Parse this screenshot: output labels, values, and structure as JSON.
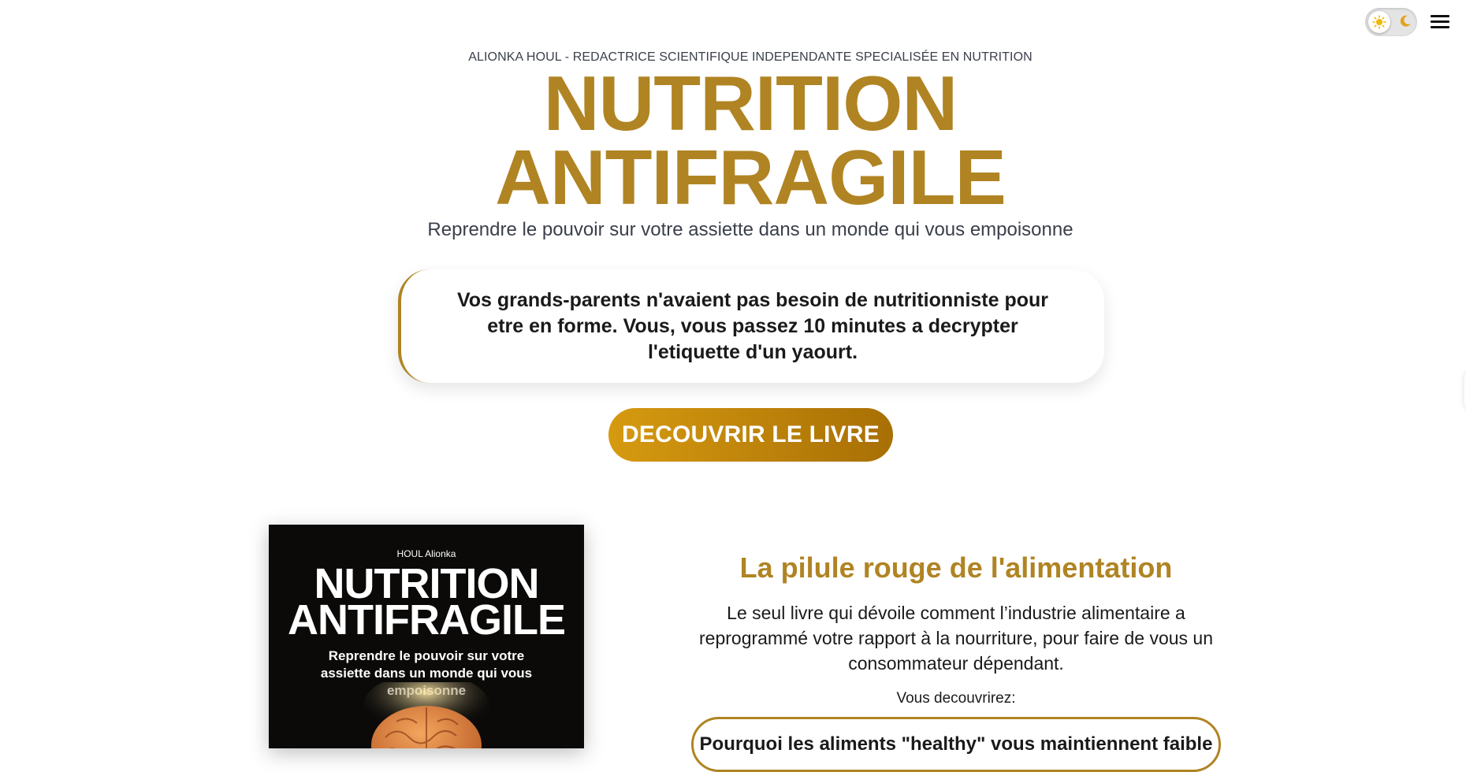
{
  "header": {
    "theme_toggle": {
      "state": "light",
      "light_icon": "sun-icon",
      "dark_icon": "moon-icon"
    },
    "menu_icon": "menu-icon"
  },
  "hero": {
    "kicker": "ALIONKA HOUL - REDACTRICE SCIENTIFIQUE INDEPENDANTE SPECIALISÉE EN NUTRITION",
    "title_line1": "NUTRITION",
    "title_line2": "ANTIFRAGILE",
    "subtitle": "Reprendre le pouvoir sur votre assiette dans un monde qui vous empoisonne",
    "quote": "Vos grands-parents n'avaient pas besoin de nutritionniste pour etre en forme. Vous, vous passez 10 minutes a decrypter l'etiquette d'un yaourt.",
    "cta_label": "DECOUVRIR LE LIVRE"
  },
  "book_cover": {
    "author": "HOUL Alionka",
    "title_line1": "NUTRITION",
    "title_line2": "ANTIFRAGILE",
    "subtitle": "Reprendre le pouvoir sur votre assiette dans un monde qui vous empoisonne",
    "illustration": "brain-illustration"
  },
  "pitch": {
    "heading": "La pilule rouge de l'alimentation",
    "body": "Le seul livre qui dévoile comment l’industrie alimentaire a reprogrammé votre rapport à la nourriture, pour faire de vous un consommateur dépendant.",
    "discover_label": "Vous decouvrirez:",
    "points": [
      "Pourquoi les aliments \"healthy\" vous maintiennent faible"
    ]
  },
  "colors": {
    "accent": "#b08423",
    "cta_start": "#d69a10",
    "cta_end": "#a86f05",
    "text": "#1a1a1a"
  }
}
